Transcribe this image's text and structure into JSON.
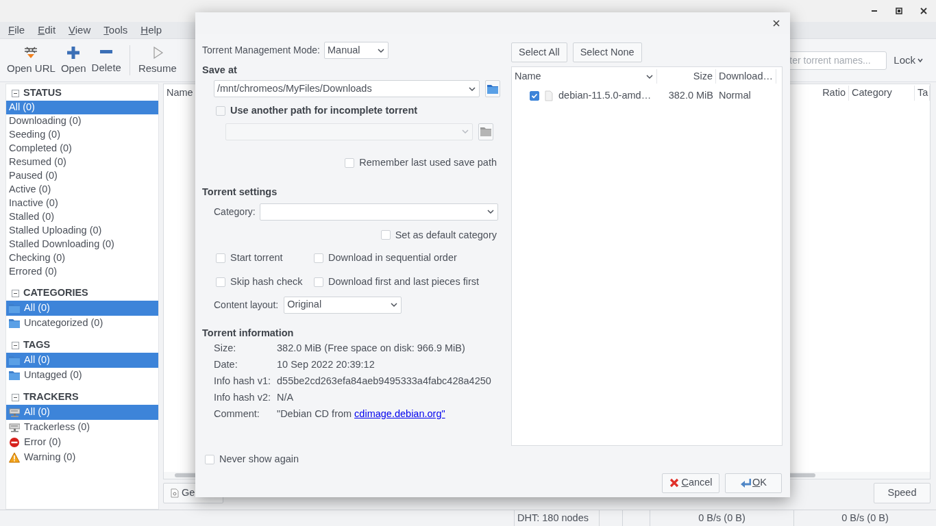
{
  "menu": [
    "File",
    "Edit",
    "View",
    "Tools",
    "Help"
  ],
  "toolbar": [
    {
      "label": "Open URL",
      "kind": "url"
    },
    {
      "label": "Open",
      "kind": "add"
    },
    {
      "label": "Delete",
      "kind": "remove"
    },
    {
      "label": "Resume",
      "kind": "play"
    }
  ],
  "search": {
    "placeholder": "ter torrent names..."
  },
  "lock": "Lock",
  "sidebar": [
    {
      "title": "STATUS",
      "expanded": true,
      "kind": "status",
      "items": [
        {
          "label": "All (0)",
          "selected": true
        },
        {
          "label": "Downloading (0)",
          "selected": false
        },
        {
          "label": "Seeding (0)",
          "selected": false
        },
        {
          "label": "Completed (0)",
          "selected": false
        },
        {
          "label": "Resumed (0)",
          "selected": false
        },
        {
          "label": "Paused (0)",
          "selected": false
        },
        {
          "label": "Active (0)",
          "selected": false
        },
        {
          "label": "Inactive (0)",
          "selected": false
        },
        {
          "label": "Stalled (0)",
          "selected": false
        },
        {
          "label": "Stalled Uploading (0)",
          "selected": false
        },
        {
          "label": "Stalled Downloading (0)",
          "selected": false
        },
        {
          "label": "Checking (0)",
          "selected": false
        },
        {
          "label": "Errored (0)",
          "selected": false
        }
      ]
    },
    {
      "title": "CATEGORIES",
      "expanded": true,
      "kind": "folders",
      "items": [
        {
          "label": "All (0)",
          "selected": true
        },
        {
          "label": "Uncategorized (0)",
          "selected": false
        }
      ]
    },
    {
      "title": "TAGS",
      "expanded": true,
      "kind": "folders",
      "items": [
        {
          "label": "All (0)",
          "selected": true
        },
        {
          "label": "Untagged (0)",
          "selected": false
        }
      ]
    },
    {
      "title": "TRACKERS",
      "expanded": true,
      "kind": "trackers",
      "items": [
        {
          "label": "All (0)",
          "selected": true,
          "kind": "tracker"
        },
        {
          "label": "Trackerless (0)",
          "selected": false,
          "kind": "tracker"
        },
        {
          "label": "Error (0)",
          "selected": false,
          "kind": "error"
        },
        {
          "label": "Warning (0)",
          "selected": false,
          "kind": "warning"
        }
      ]
    }
  ],
  "torrent_table": {
    "columns": [
      "Name",
      "Ratio",
      "Category",
      "Ta"
    ]
  },
  "bottom_tabs": [
    "Ge"
  ],
  "speed_button": "Speed",
  "status_bar": [
    "DHT: 180 nodes",
    "0 B/s (0 B)",
    "0 B/s (0 B)"
  ],
  "dialog": {
    "management_mode": {
      "label": "Torrent Management Mode:",
      "value": "Manual"
    },
    "save_at": {
      "heading": "Save at",
      "path": "/mnt/chromeos/MyFiles/Downloads"
    },
    "incomplete_path": {
      "label": "Use another path for incomplete torrent",
      "checked": false,
      "disabled": true
    },
    "remember": {
      "label": "Remember last used save path",
      "checked": false
    },
    "settings_heading": "Torrent settings",
    "category": {
      "label": "Category:"
    },
    "default_category": {
      "label": "Set as default category",
      "checked": false
    },
    "options": [
      {
        "label": "Start torrent",
        "checked": false
      },
      {
        "label": "Download in sequential order",
        "checked": false
      },
      {
        "label": "Skip hash check",
        "checked": false
      },
      {
        "label": "Download first and last pieces first",
        "checked": false
      }
    ],
    "content_layout": {
      "label": "Content layout:",
      "value": "Original"
    },
    "info_heading": "Torrent information",
    "info": [
      {
        "label": "Size:",
        "value": "382.0 MiB (Free space on disk: 966.9 MiB)"
      },
      {
        "label": "Date:",
        "value": "10 Sep 2022 20:39:12"
      },
      {
        "label": "Info hash v1:",
        "value": "d55be2cd263efa84aeb9495333a4fabc428a4250"
      },
      {
        "label": "Info hash v2:",
        "value": "N/A"
      },
      {
        "label": "Comment:",
        "value": "\"Debian CD from",
        "link": "cdimage.debian.org\""
      }
    ],
    "never_show": {
      "label": "Never show again",
      "checked": false
    },
    "select_buttons": [
      "Select All",
      "Select None"
    ],
    "files": {
      "columns": [
        "Name",
        "Size",
        "Download…"
      ],
      "rows": [
        {
          "name": "debian-11.5.0-amd…",
          "size": "382.0 MiB",
          "priority": "Normal",
          "checked": true
        }
      ]
    },
    "buttons": [
      {
        "label": "Cancel",
        "kind": "cancel"
      },
      {
        "label": "OK",
        "kind": "ok"
      }
    ]
  }
}
